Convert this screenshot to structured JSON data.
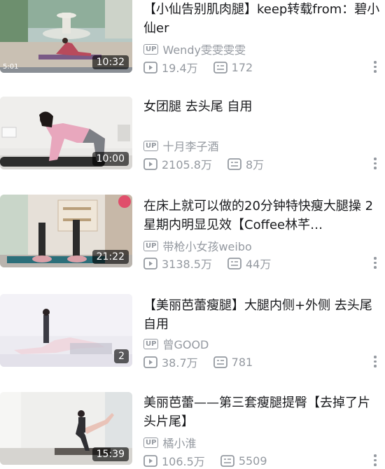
{
  "videos": [
    {
      "title": "【小仙告别肌肉腿】keep转载from：碧小仙er",
      "up_label": "UP",
      "uploader": "Wendy雯雯雯雯",
      "views": "19.4万",
      "danmaku": "172",
      "duration": "10:32",
      "thumb_overlay": "5:01"
    },
    {
      "title": "女团腿 去头尾 自用",
      "up_label": "UP",
      "uploader": "十月李子酒",
      "views": "2105.8万",
      "danmaku": "8万",
      "duration": "10:00"
    },
    {
      "title": "在床上就可以做的20分钟特快瘦大腿操 2星期内明显见效【Coffee林芊…",
      "up_label": "UP",
      "uploader": "带枪小女孩weibo",
      "views": "3138.5万",
      "danmaku": "44万",
      "duration": "21:22"
    },
    {
      "title": "【美丽芭蕾瘦腿】大腿内侧+外侧 去头尾自用",
      "up_label": "UP",
      "uploader": "曾GOOD",
      "views": "38.7万",
      "danmaku": "781",
      "parts": "2"
    },
    {
      "title": "美丽芭蕾——第三套瘦腿提臀【去掉了片头片尾】",
      "up_label": "UP",
      "uploader": "橘小淮",
      "views": "106.5万",
      "danmaku": "5509",
      "duration": "15:39"
    }
  ],
  "icons": {
    "play": "play-count-icon",
    "danmaku": "danmaku-count-icon",
    "more": "more-vertical-icon",
    "parts": "playlist-icon"
  },
  "colors": {
    "text": "#18191c",
    "meta": "#9499a0",
    "overlay": "#000000"
  }
}
